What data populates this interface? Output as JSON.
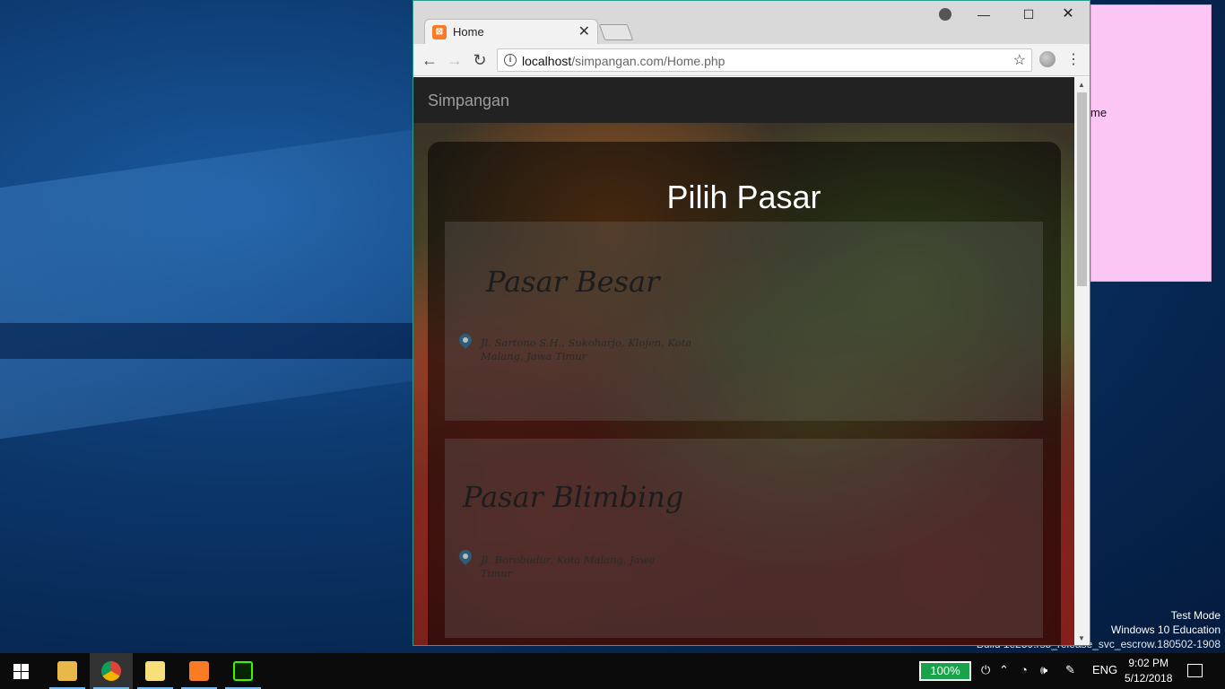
{
  "browser": {
    "tab_title": "Home",
    "tab_close": "✕",
    "url_host": "localhost",
    "url_path": "/simpangan.com/Home.php",
    "window_controls": {
      "minimize": "—",
      "maximize": "☐",
      "close": "✕"
    }
  },
  "page": {
    "brand": "Simpangan",
    "title": "Pilih Pasar",
    "markets": [
      {
        "name": "Pasar Besar",
        "address": "Jl. Sartono S.H., Sukoharjo, Klojen, Kota Malang, Jawa Timur"
      },
      {
        "name": "Pasar Blimbing",
        "address": "Jl. Borobudur, Kota Malang, Jawa Timur"
      }
    ]
  },
  "sticky_note": {
    "text": "me"
  },
  "watermark": {
    "line1": "Test Mode",
    "line2": "Windows 10 Education",
    "line3": "Build 1e259.rs5_release_svc_escrow.180502-1908"
  },
  "taskbar": {
    "battery": "100%",
    "language": "ENG",
    "time": "9:02 PM",
    "date": "5/12/2018",
    "apps": [
      "file-explorer",
      "chrome",
      "sticky-notes",
      "xampp",
      "dreamweaver"
    ]
  },
  "colors": {
    "accent_border": "#2a9d8f",
    "navbar": "#222222",
    "battery": "#18a34a",
    "sticky": "#fcc6f4"
  }
}
